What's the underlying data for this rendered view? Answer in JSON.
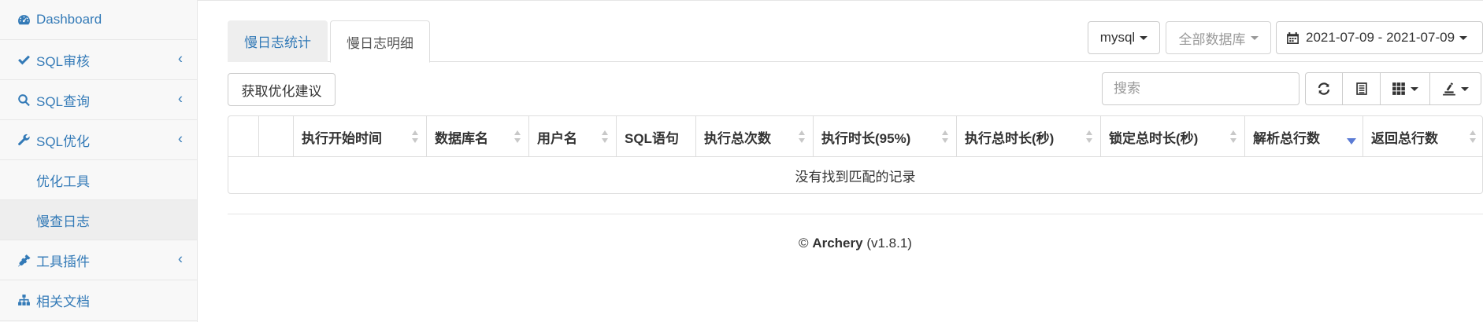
{
  "sidebar": {
    "items": [
      {
        "label": "Dashboard",
        "icon": "dashboard-icon"
      },
      {
        "label": "SQL审核",
        "icon": "check-icon",
        "chevron": "‹"
      },
      {
        "label": "SQL查询",
        "icon": "search-icon",
        "chevron": "‹"
      },
      {
        "label": "SQL优化",
        "icon": "wrench-icon",
        "chevron": "‹"
      },
      {
        "label": "优化工具"
      },
      {
        "label": "慢查日志"
      },
      {
        "label": "工具插件",
        "icon": "plug-icon",
        "chevron": "‹"
      },
      {
        "label": "相关文档",
        "icon": "sitemap-icon"
      }
    ]
  },
  "tabs": {
    "stats": "慢日志统计",
    "detail": "慢日志明细"
  },
  "filters": {
    "db_type": "mysql",
    "database": "全部数据库",
    "date_range": "2021-07-09 - 2021-07-09"
  },
  "toolbar": {
    "advice_button": "获取优化建议",
    "search_placeholder": "搜索"
  },
  "table": {
    "columns": [
      "",
      "",
      "执行开始时间",
      "数据库名",
      "用户名",
      "SQL语句",
      "执行总次数",
      "执行时长(95%)",
      "执行总时长(秒)",
      "锁定总时长(秒)",
      "解析总行数",
      "返回总行数"
    ],
    "empty_message": "没有找到匹配的记录",
    "sorted_column": "解析总行数",
    "sort_direction": "desc"
  },
  "footer": {
    "copyright": "©",
    "brand": "Archery",
    "version": "(v1.8.1)"
  },
  "colors": {
    "link": "#337ab7",
    "sidebar_bg": "#f8f8f8",
    "active_bg": "#eeeeee",
    "sort_active": "#5b7bd5"
  }
}
